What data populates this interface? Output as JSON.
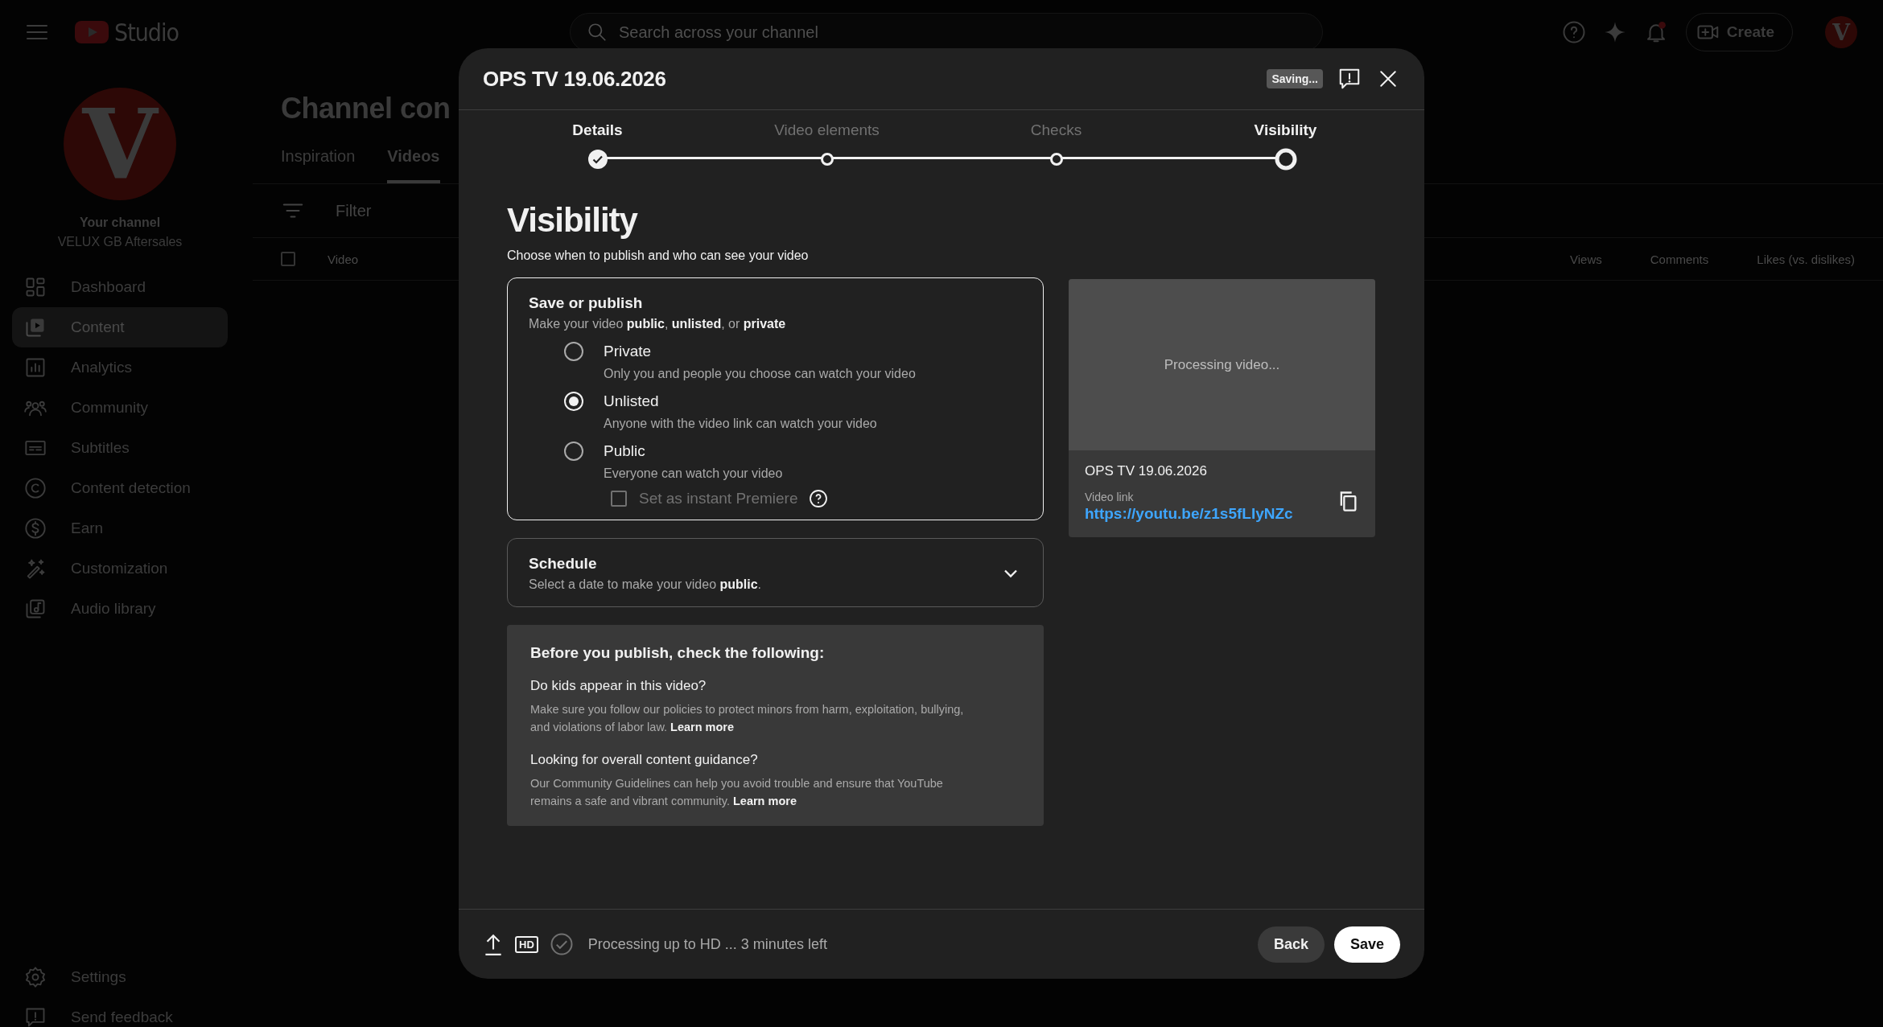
{
  "top_bar": {
    "logo_text": "Studio",
    "search": {
      "placeholder": "Search across your channel"
    },
    "create_button": "Create",
    "avatar_letter": "V"
  },
  "sidebar": {
    "avatar_letter": "V",
    "channel_title": "Your channel",
    "channel_name": "VELUX GB Aftersales",
    "items": [
      {
        "label": "Dashboard",
        "selected": false
      },
      {
        "label": "Content",
        "selected": true
      },
      {
        "label": "Analytics",
        "selected": false
      },
      {
        "label": "Community",
        "selected": false
      },
      {
        "label": "Subtitles",
        "selected": false
      },
      {
        "label": "Content detection",
        "selected": false
      },
      {
        "label": "Earn",
        "selected": false
      },
      {
        "label": "Customization",
        "selected": false
      },
      {
        "label": "Audio library",
        "selected": false
      }
    ],
    "footer_items": [
      {
        "label": "Settings"
      },
      {
        "label": "Send feedback"
      }
    ]
  },
  "page": {
    "title": "Channel con",
    "tabs": [
      {
        "label": "Inspiration",
        "selected": false
      },
      {
        "label": "Videos",
        "selected": true
      }
    ],
    "filter": {
      "placeholder": "Filter"
    },
    "table": {
      "select_all_checked": false,
      "columns": [
        "Video",
        "Views",
        "Comments",
        "Likes (vs. dislikes)"
      ]
    }
  },
  "dialog": {
    "title": "OPS TV 19.06.2026",
    "status_badge": "Saving...",
    "steps": [
      {
        "label": "Details",
        "completed": true,
        "selected": false
      },
      {
        "label": "Video elements",
        "completed": false,
        "selected": false
      },
      {
        "label": "Checks",
        "completed": false,
        "selected": false
      },
      {
        "label": "Visibility",
        "completed": false,
        "selected": true
      }
    ],
    "heading": "Visibility",
    "subheading": "Choose when to publish and who can see your video",
    "save_or_publish": {
      "title": "Save or publish",
      "description": "Make your video **public**, **unlisted**, or **private**",
      "options": [
        {
          "label": "Private",
          "description": "Only you and people you choose can watch your video",
          "selected": false
        },
        {
          "label": "Unlisted",
          "description": "Anyone with the video link can watch your video",
          "selected": true
        },
        {
          "label": "Public",
          "description": "Everyone can watch your video",
          "selected": false
        }
      ],
      "premiere": {
        "label": "Set as instant Premiere",
        "checked": false,
        "disabled": true
      }
    },
    "schedule": {
      "title": "Schedule",
      "description": "Select a date to make your video **public**.",
      "expanded": false
    },
    "checklist": {
      "title": "Before you publish, check the following:",
      "sections": [
        {
          "title": "Do kids appear in this video?",
          "text": "Make sure you follow our policies to protect minors from harm, exploitation, bullying, and violations of labor law.",
          "link": "Learn more"
        },
        {
          "title": "Looking for overall content guidance?",
          "text": "Our Community Guidelines can help you avoid trouble and ensure that YouTube remains a safe and vibrant community.",
          "link": "Learn more"
        }
      ]
    },
    "preview": {
      "status": "Processing video...",
      "title": "OPS TV 19.06.2026",
      "link_label": "Video link",
      "link": "https://youtu.be/z1s5fLIyNZc"
    },
    "footer": {
      "hd_badge": "HD",
      "status": "Processing up to HD ... 3 minutes left",
      "buttons": [
        {
          "label": "Back",
          "kind": "secondary"
        },
        {
          "label": "Save",
          "kind": "primary"
        }
      ]
    }
  }
}
